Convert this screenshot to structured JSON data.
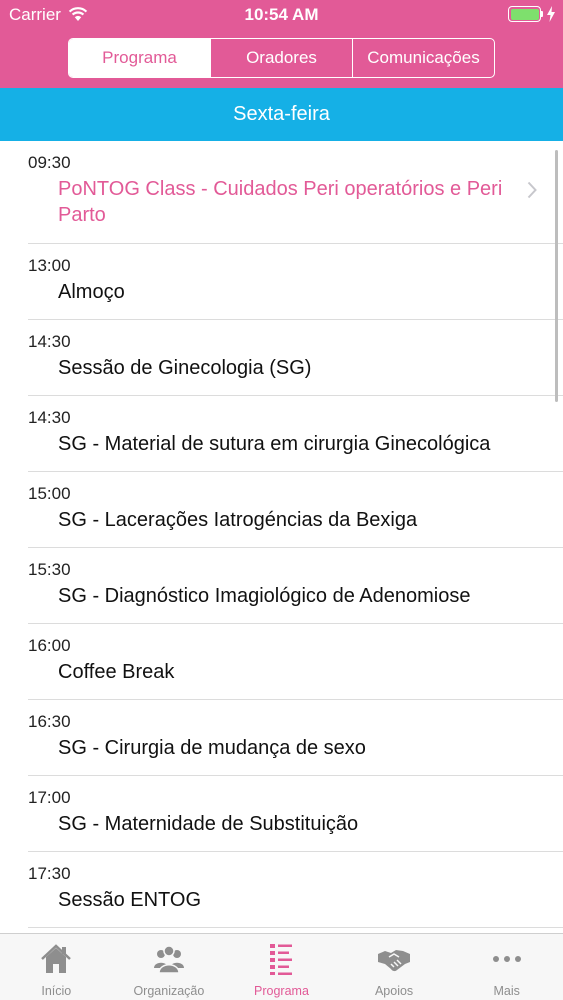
{
  "status": {
    "carrier": "Carrier",
    "time": "10:54 AM"
  },
  "segments": [
    "Programa",
    "Oradores",
    "Comunicações"
  ],
  "active_segment": "Programa",
  "day": "Sexta-feira",
  "items": [
    {
      "time": "09:30",
      "title": "PoNTOG Class - Cuidados Peri operatórios e Peri Parto"
    },
    {
      "time": "13:00",
      "title": "Almoço"
    },
    {
      "time": "14:30",
      "title": "Sessão de Ginecologia (SG)"
    },
    {
      "time": "14:30",
      "title": "SG - Material de sutura em cirurgia Ginecológica"
    },
    {
      "time": "15:00",
      "title": "SG - Lacerações Iatrogéncias da Bexiga"
    },
    {
      "time": "15:30",
      "title": "SG - Diagnóstico Imagiológico de Adenomiose"
    },
    {
      "time": "16:00",
      "title": "Coffee Break"
    },
    {
      "time": "16:30",
      "title": "SG - Cirurgia de mudança de sexo"
    },
    {
      "time": "17:00",
      "title": "SG - Maternidade de Substituição"
    },
    {
      "time": "17:30",
      "title": "Sessão ENTOG"
    }
  ],
  "tabs": [
    {
      "label": "Início",
      "icon": "home-icon"
    },
    {
      "label": "Organização",
      "icon": "people-icon"
    },
    {
      "label": "Programa",
      "icon": "program-list-icon"
    },
    {
      "label": "Apoios",
      "icon": "handshake-icon"
    },
    {
      "label": "Mais",
      "icon": "more-icon"
    }
  ],
  "active_tab": "Programa",
  "colors": {
    "accent": "#e25a97",
    "day_band": "#15b0e6",
    "inactive_tab": "#8e8e8e"
  }
}
